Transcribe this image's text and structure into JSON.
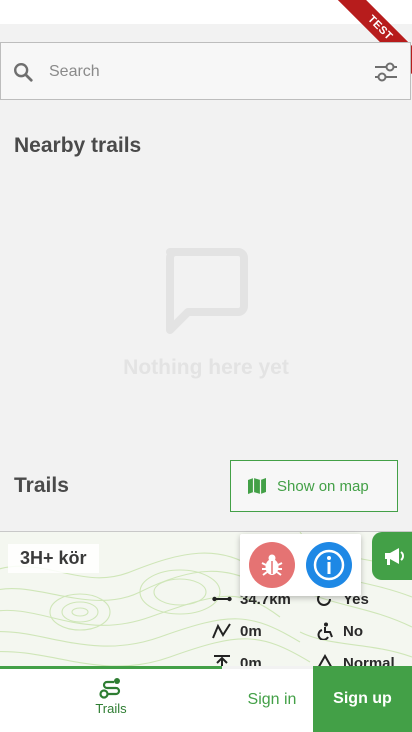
{
  "search": {
    "placeholder": "Search"
  },
  "test_banner": "TEST",
  "nearby": {
    "title": "Nearby trails",
    "empty_text": "Nothing here yet"
  },
  "trails": {
    "title": "Trails",
    "map_button_label": "Show on map",
    "card": {
      "name": "3H+ kör",
      "length": "34.7km",
      "loop": "Yes",
      "elevation_gain": "0m",
      "accessible": "No",
      "elevation_max": "0m",
      "difficulty": "Normal"
    }
  },
  "progress": {
    "fraction": 0.54
  },
  "bottom_nav": {
    "trails_label": "Trails",
    "sign_in_label": "Sign in",
    "sign_up_label": "Sign up"
  },
  "colors": {
    "accent": "#43a047",
    "debug_bug": "#e57373",
    "debug_info": "#1e88e5",
    "test_ribbon": "#b71c1c"
  }
}
